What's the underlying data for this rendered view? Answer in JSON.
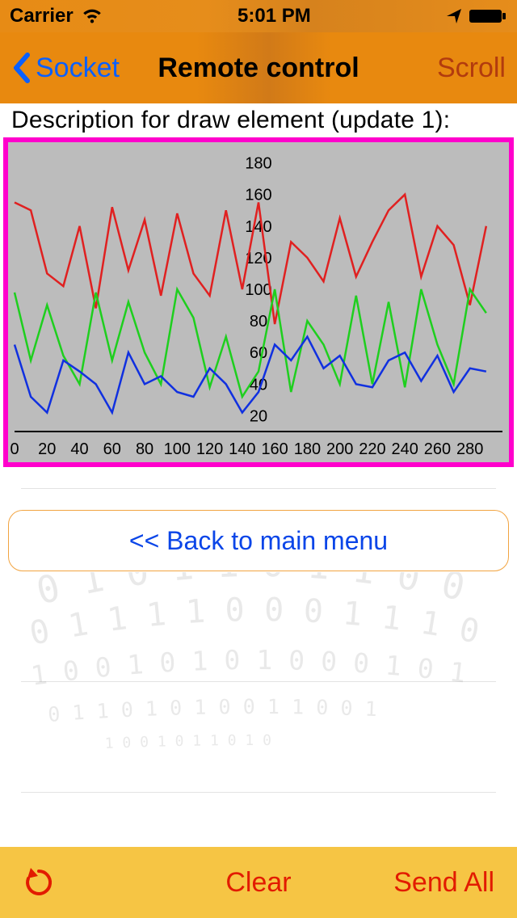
{
  "statusbar": {
    "carrier": "Carrier",
    "time": "5:01 PM"
  },
  "nav": {
    "back_label": "Socket",
    "title": "Remote control",
    "right_label": "Scroll"
  },
  "description": "Description for draw element (update 1):",
  "back_button": "<< Back to main menu",
  "toolbar": {
    "clear": "Clear",
    "send_all": "Send All"
  },
  "colors": {
    "accent_orange": "#e8890f",
    "link_blue": "#0a60ff",
    "btn_blue": "#0a45e8",
    "toolbar_bg": "#f6c544",
    "toolbar_fg": "#e21b00",
    "chart_border": "#ff00cc",
    "chart_bg": "#bcbcbc",
    "series_red": "#e02020",
    "series_green": "#1ecf1e",
    "series_blue": "#1030e0"
  },
  "chart_data": {
    "type": "line",
    "x": [
      0,
      10,
      20,
      30,
      40,
      50,
      60,
      70,
      80,
      90,
      100,
      110,
      120,
      130,
      140,
      150,
      160,
      170,
      180,
      190,
      200,
      210,
      220,
      230,
      240,
      250,
      260,
      270,
      280,
      290
    ],
    "x_ticks": [
      0,
      20,
      40,
      60,
      80,
      100,
      120,
      140,
      160,
      180,
      200,
      220,
      240,
      260,
      280
    ],
    "y_ticks": [
      20,
      40,
      60,
      80,
      100,
      120,
      140,
      160,
      180
    ],
    "ylim": [
      10,
      190
    ],
    "xlim": [
      0,
      300
    ],
    "series": [
      {
        "name": "red",
        "color": "#e02020",
        "values": [
          155,
          150,
          110,
          102,
          140,
          88,
          152,
          112,
          144,
          96,
          148,
          110,
          96,
          150,
          100,
          155,
          78,
          130,
          120,
          105,
          145,
          108,
          130,
          150,
          160,
          108,
          140,
          128,
          90,
          140
        ]
      },
      {
        "name": "green",
        "color": "#1ecf1e",
        "values": [
          98,
          55,
          90,
          58,
          40,
          98,
          55,
          92,
          60,
          40,
          100,
          82,
          38,
          70,
          32,
          48,
          100,
          35,
          80,
          65,
          40,
          96,
          40,
          92,
          38,
          100,
          65,
          40,
          100,
          85
        ]
      },
      {
        "name": "blue",
        "color": "#1030e0",
        "values": [
          65,
          32,
          22,
          55,
          48,
          40,
          22,
          60,
          40,
          45,
          35,
          32,
          50,
          40,
          22,
          35,
          65,
          55,
          70,
          50,
          58,
          40,
          38,
          55,
          60,
          42,
          58,
          35,
          50,
          48
        ]
      }
    ]
  }
}
